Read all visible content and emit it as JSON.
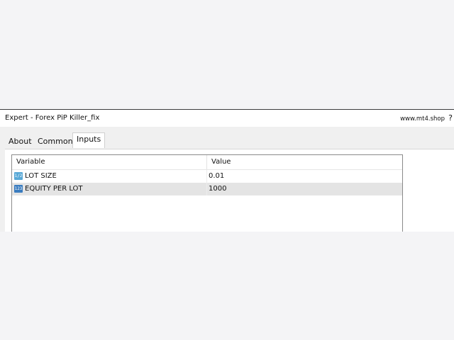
{
  "window": {
    "title": "Expert - Forex PiP Killer_fix",
    "brand": "www.mt4.shop",
    "help_label": "?"
  },
  "tabs": [
    {
      "label": "About",
      "active": false
    },
    {
      "label": "Common",
      "active": false
    },
    {
      "label": "Inputs",
      "active": true
    }
  ],
  "inputs_table": {
    "columns": [
      "Variable",
      "Value"
    ],
    "rows": [
      {
        "icon": "fraction-type-icon",
        "icon_text": "1/2",
        "name": "LOT SIZE",
        "value": "0.01",
        "selected": false
      },
      {
        "icon": "integer-type-icon",
        "icon_text": "123",
        "name": "EQUITY PER LOT",
        "value": "1000",
        "selected": true
      }
    ]
  },
  "colors": {
    "background": "#f4f4f6",
    "panel": "#ffffff",
    "selected_row": "#e4e4e4",
    "icon_fraction": "#58a8d6",
    "icon_integer": "#3a7cbf"
  }
}
